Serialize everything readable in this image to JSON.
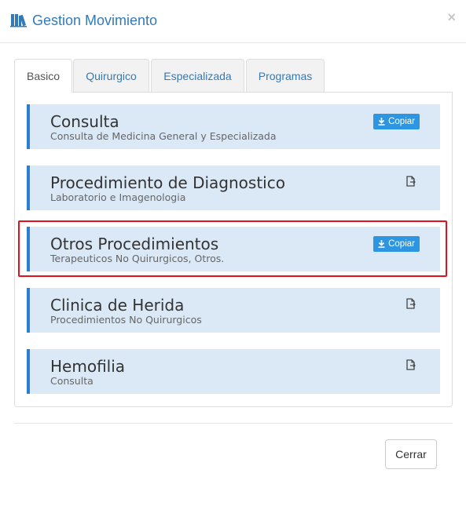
{
  "header": {
    "title": "Gestion Movimiento",
    "title_icon": "books-icon",
    "close_symbol": "×"
  },
  "tabs": [
    {
      "label": "Basico",
      "active": true
    },
    {
      "label": "Quirurgico",
      "active": false
    },
    {
      "label": "Especializada",
      "active": false
    },
    {
      "label": "Programas",
      "active": false
    }
  ],
  "items": [
    {
      "title": "Consulta",
      "subtitle": "Consulta de Medicina General y Especializada",
      "action": "copy",
      "action_label": "Copiar"
    },
    {
      "title": "Procedimiento de Diagnostico",
      "subtitle": "Laboratorio e Imagenologia",
      "action": "document-icon"
    },
    {
      "title": "Otros Procedimientos",
      "subtitle": "Terapeuticos No Quirurgicos, Otros.",
      "action": "copy",
      "action_label": "Copiar",
      "highlighted": true
    },
    {
      "title": "Clinica de Herida",
      "subtitle": "Procedimientos No Quirurgicos",
      "action": "document-icon"
    },
    {
      "title": "Hemofilia",
      "subtitle": "Consulta",
      "action": "document-icon"
    }
  ],
  "footer": {
    "close_label": "Cerrar"
  },
  "colors": {
    "accent": "#337ab7",
    "item_bg": "#dbe8f6",
    "item_border": "#2b7fd0",
    "copy_button": "#2e96e0",
    "highlight": "#e0121f"
  }
}
